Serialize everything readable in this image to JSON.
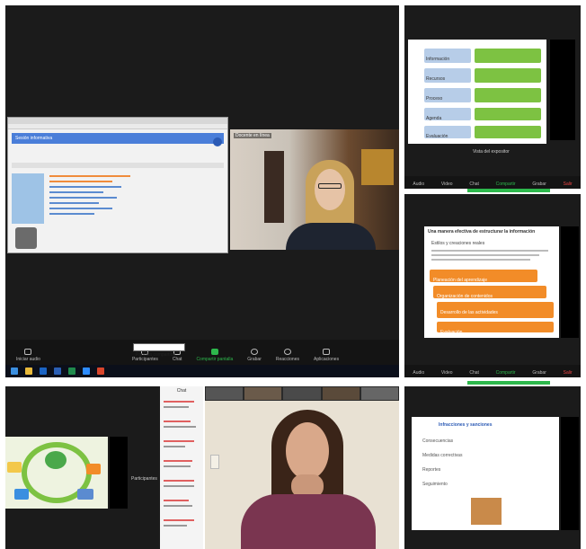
{
  "panel_top_left": {
    "browser_title": "Sesión informativa",
    "presenter_label": "Docente en línea",
    "toolbar": [
      {
        "label": "Iniciar audio",
        "icon": "mic-icon"
      },
      {
        "label": "Participantes",
        "icon": "participants-icon"
      },
      {
        "label": "Chat",
        "icon": "chat-icon"
      },
      {
        "label": "Compartir pantalla",
        "icon": "share-icon"
      },
      {
        "label": "Grabar",
        "icon": "record-icon"
      },
      {
        "label": "Reacciones",
        "icon": "reactions-icon"
      },
      {
        "label": "Aplicaciones",
        "icon": "apps-icon"
      }
    ],
    "share_notice": "Pantalla compartida"
  },
  "panel_top_right": {
    "slide_rows": [
      "Información",
      "Recursos",
      "Proceso",
      "Agenda",
      "Evaluación"
    ],
    "caption": "Vista del expositor",
    "toolbar": [
      "Audio",
      "Video",
      "Chat",
      "Compartir",
      "Grabar",
      "Salir"
    ]
  },
  "panel_mid_right": {
    "slide_title": "Una manera efectiva de estructurar la información",
    "subtitle": "Estilos y creaciones reales",
    "steps": [
      "Planeación del aprendizaje",
      "Organización de contenidos",
      "Desarrollo de las actividades",
      "Evaluación"
    ],
    "toolbar": [
      "Audio",
      "Video",
      "Chat",
      "Compartir",
      "Grabar",
      "Salir"
    ]
  },
  "panel_bottom": {
    "chat_title": "Chat",
    "side_label": "Participantes",
    "slide_title": "Infracciones y sanciones",
    "bullets": [
      "Consecuencias",
      "Medidas correctivas",
      "Reportes",
      "Seguimiento"
    ]
  },
  "colors": {
    "zoom_green": "#2db84c",
    "slide_green": "#7dc242",
    "slide_orange": "#f28c28",
    "slide_blue": "#b7cde8"
  }
}
